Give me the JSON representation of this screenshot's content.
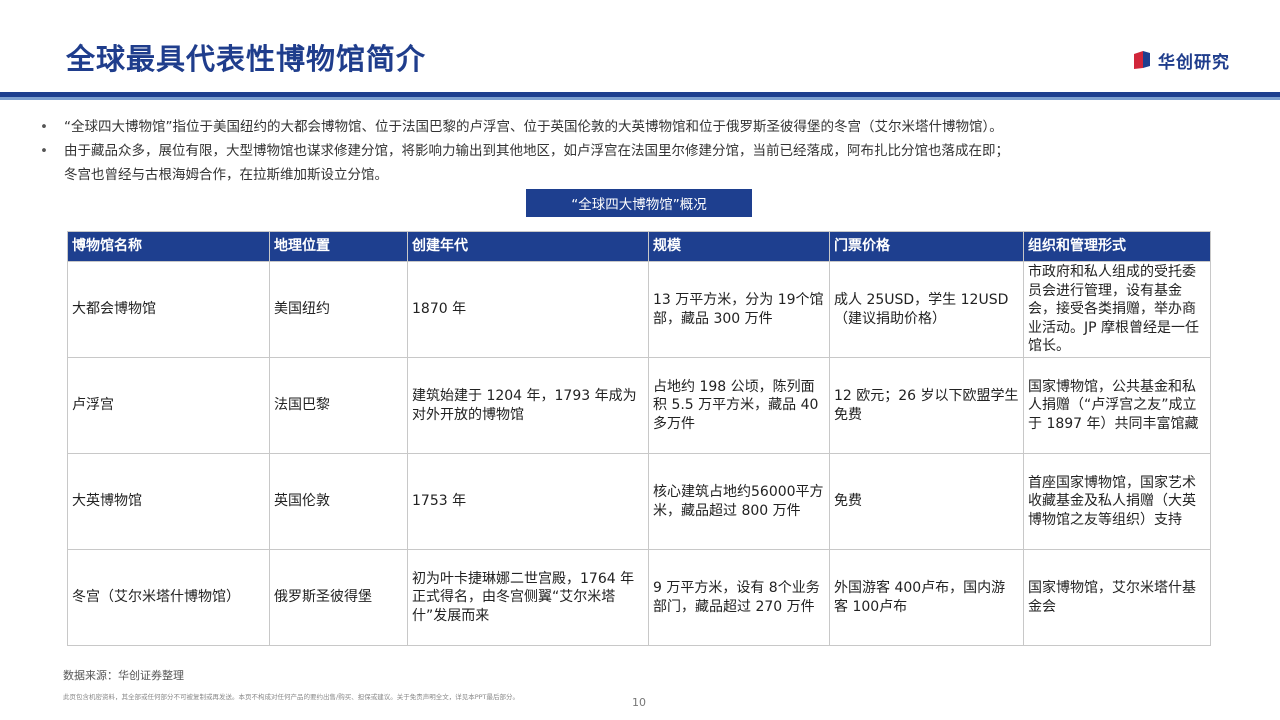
{
  "header": {
    "title": "全球最具代表性博物馆简介",
    "brand": "华创研究",
    "brand_colors": {
      "primary": "#1e3f8f",
      "accent": "#d1263a"
    }
  },
  "bullets": [
    {
      "lines": [
        "“全球四大博物馆”指位于美国纽约的大都会博物馆、位于法国巴黎的卢浮宫、位于英国伦敦的大英博物馆和位于俄罗斯圣彼得堡的冬宫（艾尔米塔什博物馆）。"
      ]
    },
    {
      "lines": [
        "由于藏品众多，展位有限，大型博物馆也谋求修建分馆，将影响力输出到其他地区，如卢浮宫在法国里尔修建分馆，当前已经落成，阿布扎比分馆也落成在即；",
        "冬宫也曾经与古根海姆合作，在拉斯维加斯设立分馆。"
      ]
    }
  ],
  "table": {
    "caption": "“全球四大博物馆”概况",
    "headers": [
      "博物馆名称",
      "地理位置",
      "创建年代",
      "规模",
      "门票价格",
      "组织和管理形式"
    ],
    "rows": [
      [
        "大都会博物馆",
        "美国纽约",
        "1870 年",
        "13 万平方米，分为 19个馆部，藏品 300 万件",
        "成人 25USD，学生 12USD（建议捐助价格）",
        "市政府和私人组成的受托委员会进行管理，设有基金会，接受各类捐赠，举办商业活动。JP 摩根曾经是一任馆长。"
      ],
      [
        "卢浮宫",
        "法国巴黎",
        "建筑始建于 1204 年，1793 年成为对外开放的博物馆",
        "占地约 198 公顷，陈列面积 5.5 万平方米，藏品 40 多万件",
        "12 欧元；26 岁以下欧盟学生免费",
        "国家博物馆，公共基金和私人捐赠（“卢浮宫之友”成立于 1897 年）共同丰富馆藏"
      ],
      [
        "大英博物馆",
        "英国伦敦",
        "1753 年",
        "核心建筑占地约56000平方米，藏品超过 800 万件",
        "免费",
        "首座国家博物馆，国家艺术收藏基金及私人捐赠（大英博物馆之友等组织）支持"
      ],
      [
        "冬宫（艾尔米塔什博物馆）",
        "俄罗斯圣彼得堡",
        "初为叶卡捷琳娜二世宫殿，1764 年正式得名，由冬宫侧翼“艾尔米塔什”发展而来",
        "9 万平方米，设有 8个业务部门，藏品超过 270 万件",
        "外国游客 400卢布，国内游客 100卢布",
        "国家博物馆，艾尔米塔什基金会"
      ]
    ]
  },
  "footer": {
    "source": "数据来源：华创证券整理",
    "disclaimer": "此页包含机密资料，其全部或任何部分不可被复制或再发送。本页不构成对任何产品的要约出售/购买、担保或建议。关于免责声明全文，详见本PPT最后部分。",
    "page_number": "10"
  }
}
